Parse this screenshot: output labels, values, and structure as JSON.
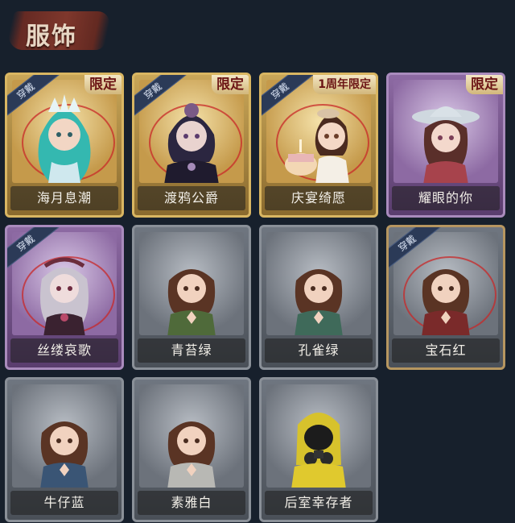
{
  "section": {
    "title": "服饰"
  },
  "badges": {
    "equipped": "穿戴",
    "limited": "限定",
    "anniversary_limited": "1周年限定"
  },
  "outfits": [
    {
      "name": "海月息潮",
      "tier": "gold",
      "equipped": true,
      "tag": "限定"
    },
    {
      "name": "渡鸦公爵",
      "tier": "gold",
      "equipped": true,
      "tag": "限定"
    },
    {
      "name": "庆宴绮愿",
      "tier": "gold",
      "equipped": true,
      "tag": "1周年限定"
    },
    {
      "name": "耀眼的你",
      "tier": "purple",
      "equipped": false,
      "tag": "限定"
    },
    {
      "name": "丝缕哀歌",
      "tier": "purple",
      "equipped": true,
      "tag": ""
    },
    {
      "name": "青苔绿",
      "tier": "gray",
      "equipped": false,
      "tag": ""
    },
    {
      "name": "孔雀绿",
      "tier": "gray",
      "equipped": false,
      "tag": ""
    },
    {
      "name": "宝石红",
      "tier": "gray",
      "equipped": true,
      "tag": ""
    },
    {
      "name": "牛仔蓝",
      "tier": "gray",
      "equipped": false,
      "tag": ""
    },
    {
      "name": "素雅白",
      "tier": "gray",
      "equipped": false,
      "tag": ""
    },
    {
      "name": "后室幸存者",
      "tier": "gray",
      "equipped": false,
      "tag": ""
    }
  ],
  "colors": {
    "background": "#17202c",
    "gold": "#d9b662",
    "purple": "#a98bbd",
    "gray": "#8a9098",
    "limited_text": "#6b1414"
  }
}
